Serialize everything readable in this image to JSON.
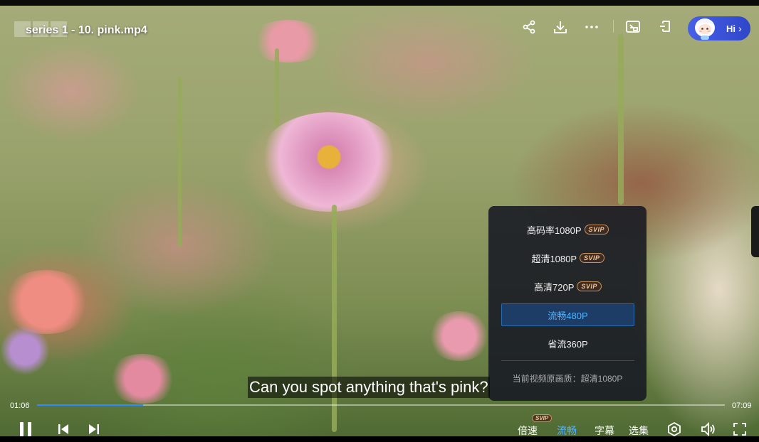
{
  "window": {
    "title": "series 1 - 10. pink.mp4"
  },
  "top_actions": [
    {
      "name": "share-icon"
    },
    {
      "name": "download-icon"
    },
    {
      "name": "more-icon"
    },
    {
      "name": "picture-in-picture-icon"
    },
    {
      "name": "pin-icon"
    }
  ],
  "assistant": {
    "label": "Hi",
    "chevron": "›"
  },
  "quality_menu": {
    "options": [
      {
        "label": "高码率1080P",
        "badge": "SVIP",
        "selected": false
      },
      {
        "label": "超清1080P",
        "badge": "SVIP",
        "selected": false
      },
      {
        "label": "高清720P",
        "badge": "SVIP",
        "selected": false
      },
      {
        "label": "流畅480P",
        "badge": "",
        "selected": true
      },
      {
        "label": "省流360P",
        "badge": "",
        "selected": false
      }
    ],
    "note": "当前视频原画质：超清1080P"
  },
  "subtitle": "Can you spot anything that's pink?",
  "playback": {
    "current_time": "01:06",
    "total_time": "07:09",
    "progress_fraction": 0.154
  },
  "controls": {
    "speed_label": "倍速",
    "speed_badge": "SVIP",
    "quality_label": "流畅",
    "subtitle_label": "字幕",
    "episodes_label": "选集"
  },
  "colors": {
    "accent": "#2f8cff",
    "selected_text": "#4fb4ff",
    "assistant_pill": "#3a52d8"
  }
}
